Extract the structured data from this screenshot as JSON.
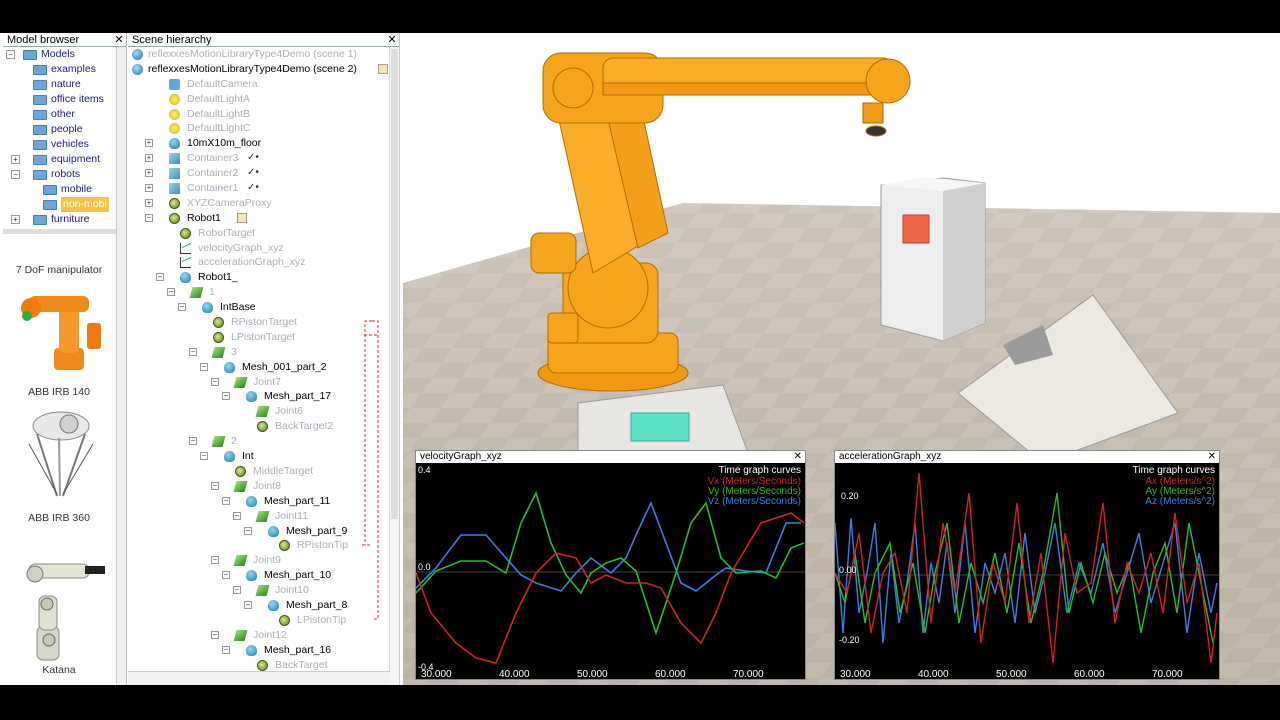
{
  "model_browser": {
    "title": "Model browser",
    "tree": [
      {
        "label": "Models",
        "level": 0,
        "expander": "-"
      },
      {
        "label": "examples",
        "level": 1
      },
      {
        "label": "nature",
        "level": 1
      },
      {
        "label": "office items",
        "level": 1
      },
      {
        "label": "other",
        "level": 1
      },
      {
        "label": "people",
        "level": 1
      },
      {
        "label": "vehicles",
        "level": 1
      },
      {
        "label": "equipment",
        "level": 1,
        "expander": "+"
      },
      {
        "label": "robots",
        "level": 1,
        "expander": "-"
      },
      {
        "label": "mobile",
        "level": 2
      },
      {
        "label": "non-mobi",
        "level": 2,
        "selected": true
      },
      {
        "label": "furniture",
        "level": 1,
        "expander": "+"
      }
    ],
    "thumbnails": [
      {
        "label": "7 DoF manipulator"
      },
      {
        "label": "ABB IRB 140"
      },
      {
        "label": "ABB IRB 360"
      },
      {
        "label": "Katana"
      }
    ]
  },
  "scene_hierarchy": {
    "title": "Scene hierarchy",
    "rows": [
      {
        "label": "reflexxesMotionLibraryType4Demo (scene 1)",
        "indent": 0,
        "icon": "scene",
        "dim": true
      },
      {
        "label": "reflexxesMotionLibraryType4Demo (scene 2)",
        "indent": 0,
        "icon": "scene",
        "extra": "script"
      },
      {
        "label": "DefaultCamera",
        "indent": 1,
        "icon": "cam",
        "dim": true
      },
      {
        "label": "DefaultLightA",
        "indent": 1,
        "icon": "light",
        "dim": true
      },
      {
        "label": "DefaultLightB",
        "indent": 1,
        "icon": "light",
        "dim": true
      },
      {
        "label": "DefaultLightC",
        "indent": 1,
        "icon": "light",
        "dim": true
      },
      {
        "label": "10mX10m_floor",
        "indent": 1,
        "icon": "shape",
        "ex": "+"
      },
      {
        "label": "Container3",
        "indent": 1,
        "icon": "cube",
        "ex": "+",
        "dim": true,
        "extra": "check"
      },
      {
        "label": "Container2",
        "indent": 1,
        "icon": "cube",
        "ex": "+",
        "dim": true,
        "extra": "check"
      },
      {
        "label": "Container1",
        "indent": 1,
        "icon": "cube",
        "ex": "+",
        "dim": true,
        "extra": "check"
      },
      {
        "label": "XYZCameraProxy",
        "indent": 1,
        "icon": "dummy",
        "ex": "+",
        "dim": true
      },
      {
        "label": "Robot1",
        "indent": 1,
        "icon": "dummy",
        "ex": "-",
        "extra": "script"
      },
      {
        "label": "RobotTarget",
        "indent": 2,
        "icon": "dummy",
        "dim": true
      },
      {
        "label": "velocityGraph_xyz",
        "indent": 2,
        "icon": "graph",
        "dim": true
      },
      {
        "label": "accelerationGraph_xyz",
        "indent": 2,
        "icon": "graph",
        "dim": true
      },
      {
        "label": "Robot1_",
        "indent": 2,
        "icon": "shape",
        "ex": "-"
      },
      {
        "label": "1",
        "indent": 3,
        "icon": "joint",
        "ex": "-",
        "dim": true
      },
      {
        "label": "IntBase",
        "indent": 4,
        "icon": "shape",
        "ex": "-"
      },
      {
        "label": "RPistonTarget",
        "indent": 5,
        "icon": "dummy",
        "dim": true
      },
      {
        "label": "LPistonTarget",
        "indent": 5,
        "icon": "dummy",
        "dim": true
      },
      {
        "label": "3",
        "indent": 5,
        "icon": "joint",
        "ex": "-",
        "dim": true
      },
      {
        "label": "Mesh_001_part_2",
        "indent": 6,
        "icon": "shape",
        "ex": "-"
      },
      {
        "label": "Joint7",
        "indent": 7,
        "icon": "joint",
        "ex": "-",
        "dim": true
      },
      {
        "label": "Mesh_part_17",
        "indent": 8,
        "icon": "shape",
        "ex": "-"
      },
      {
        "label": "Joint6",
        "indent": 9,
        "icon": "joint",
        "dim": true
      },
      {
        "label": "BackTarget2",
        "indent": 9,
        "icon": "dummy",
        "dim": true
      },
      {
        "label": "2",
        "indent": 5,
        "icon": "joint",
        "ex": "-",
        "dim": true
      },
      {
        "label": "Int",
        "indent": 6,
        "icon": "shape",
        "ex": "-"
      },
      {
        "label": "MiddleTarget",
        "indent": 7,
        "icon": "dummy",
        "dim": true
      },
      {
        "label": "Joint8",
        "indent": 7,
        "icon": "joint",
        "ex": "-",
        "dim": true
      },
      {
        "label": "Mesh_part_11",
        "indent": 8,
        "icon": "shape",
        "ex": "-"
      },
      {
        "label": "Joint11",
        "indent": 9,
        "icon": "joint",
        "ex": "-",
        "dim": true
      },
      {
        "label": "Mesh_part_9",
        "indent": 10,
        "icon": "shape",
        "ex": "-"
      },
      {
        "label": "RPistonTip",
        "indent": 11,
        "icon": "dummy",
        "dim": true
      },
      {
        "label": "Joint9",
        "indent": 7,
        "icon": "joint",
        "ex": "-",
        "dim": true
      },
      {
        "label": "Mesh_part_10",
        "indent": 8,
        "icon": "shape",
        "ex": "-"
      },
      {
        "label": "Joint10",
        "indent": 9,
        "icon": "joint",
        "ex": "-",
        "dim": true
      },
      {
        "label": "Mesh_part_8",
        "indent": 10,
        "icon": "shape",
        "ex": "-"
      },
      {
        "label": "LPistonTip",
        "indent": 11,
        "icon": "dummy",
        "dim": true
      },
      {
        "label": "Joint12",
        "indent": 7,
        "icon": "joint",
        "ex": "-",
        "dim": true
      },
      {
        "label": "Mesh_part_16",
        "indent": 8,
        "icon": "shape",
        "ex": "-"
      },
      {
        "label": "BackTarget",
        "indent": 9,
        "icon": "dummy",
        "dim": true
      }
    ]
  },
  "velocity_graph": {
    "title": "velocityGraph_xyz",
    "legend_title": "Time graph curves",
    "legend": [
      {
        "label": "Vx (Meters/Seconds)",
        "color": "#d42020"
      },
      {
        "label": "Vy (Meters/Seconds)",
        "color": "#22c02a"
      },
      {
        "label": "Vz (Meters/Seconds)",
        "color": "#3a80e0"
      }
    ],
    "y_labels": {
      "top": "0.4",
      "zero": "0.0",
      "bottom": "-0.4"
    },
    "x_labels": [
      "30.000",
      "40.000",
      "50.000",
      "60.000",
      "70.000"
    ]
  },
  "acceleration_graph": {
    "title": "accelerationGraph_xyz",
    "legend_title": "Time graph curves",
    "legend": [
      {
        "label": "Ax (Meters/s^2)",
        "color": "#d42020"
      },
      {
        "label": "Ay (Meters/s^2)",
        "color": "#22c02a"
      },
      {
        "label": "Az (Meters/s^2)",
        "color": "#3a80e0"
      }
    ],
    "y_labels": {
      "top": "0.20",
      "zero": "0.00",
      "bottom": "-0.20"
    },
    "x_labels": [
      "30.000",
      "40.000",
      "50.000",
      "60.000",
      "70.000"
    ]
  },
  "colors": {
    "robot_orange": "#f7a51c",
    "floor_tile_a": "#c9bfb4",
    "floor_tile_b": "#b9afa3",
    "sky": "#ffffff",
    "target_red": "#f06040",
    "target_cyan": "#4fe0c0"
  }
}
